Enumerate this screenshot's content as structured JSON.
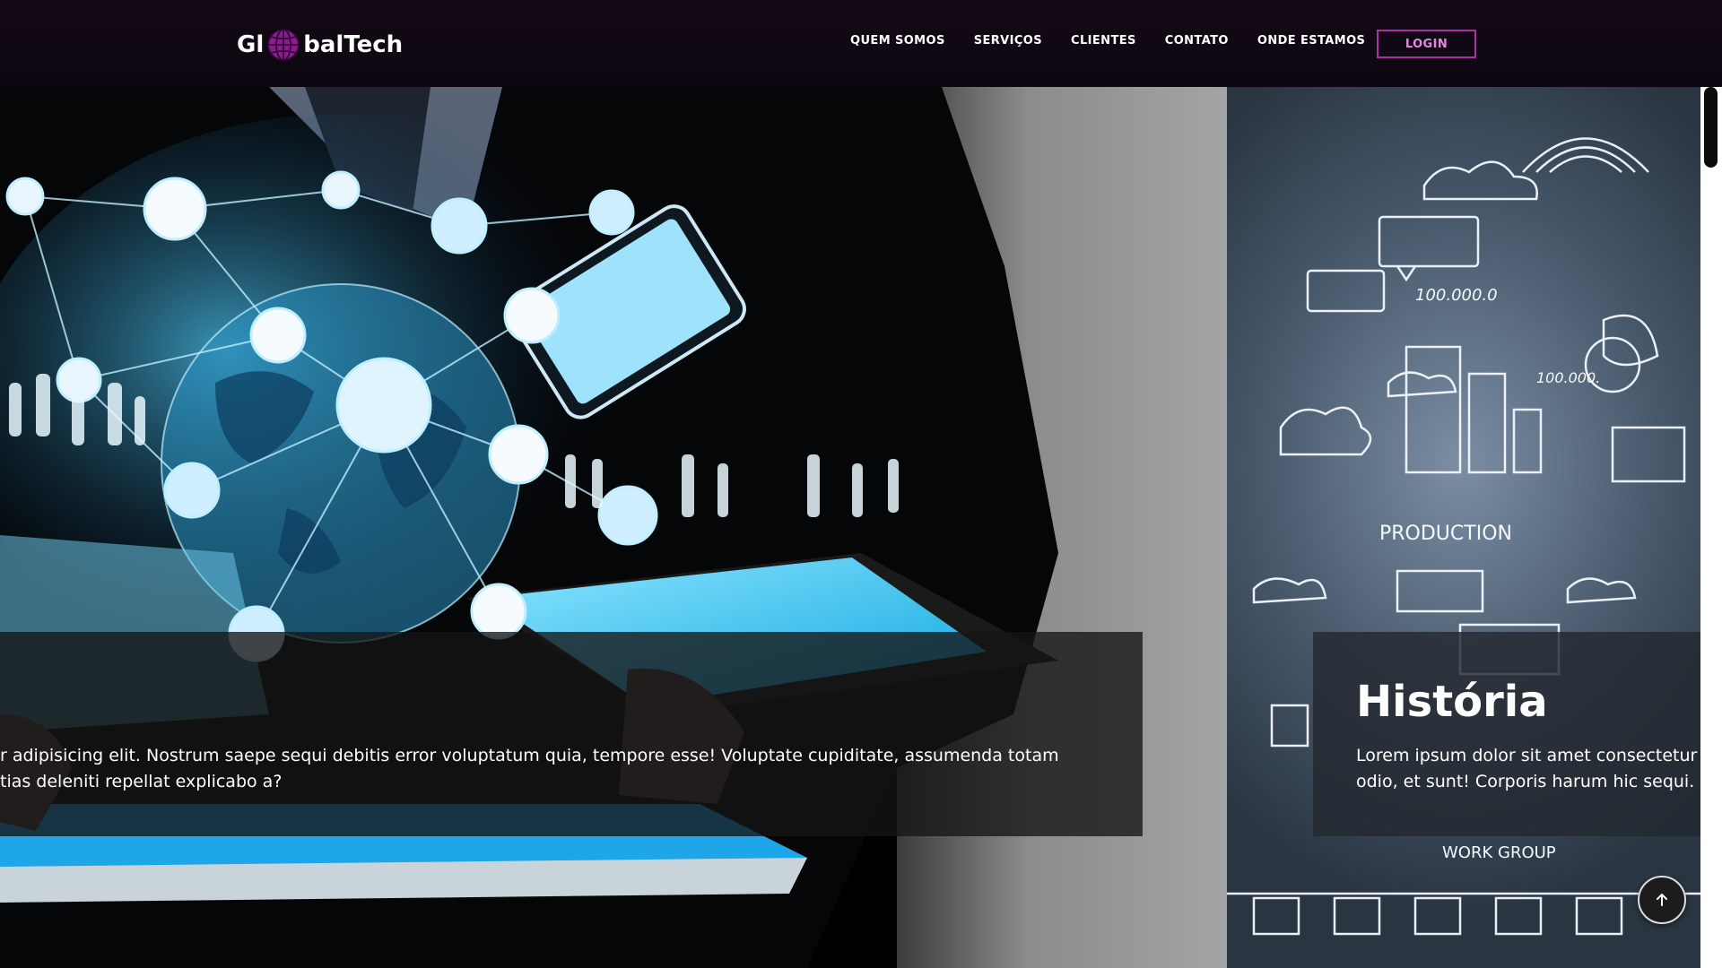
{
  "brand": {
    "name_left": "Gl",
    "name_right": "balTech",
    "globe_color": "#8b1a8f"
  },
  "nav": {
    "items": [
      "QUEM SOMOS",
      "SERVIÇOS",
      "CLIENTES",
      "CONTATO",
      "ONDE ESTAMOS"
    ],
    "login_label": "LOGIN",
    "login_color": "#a533a1"
  },
  "slides": {
    "main": {
      "text": "r adipisicing elit. Nostrum saepe sequi debitis error voluptatum quia, tempore esse! Voluptate cupiditate, assumenda totam\ntias deleniti repellat explicabo a?"
    },
    "side": {
      "title": "História",
      "text": "Lorem ipsum dolor sit amet consectetur\nodio, et sunt! Corporis harum hic sequi."
    }
  },
  "sketch_labels": [
    "100.000.0",
    "100.000.",
    "PRODUCTION",
    "WORK GROUP"
  ],
  "icons": {
    "back_to_top": "arrow-up-icon",
    "logo_globe": "globe-icon"
  }
}
